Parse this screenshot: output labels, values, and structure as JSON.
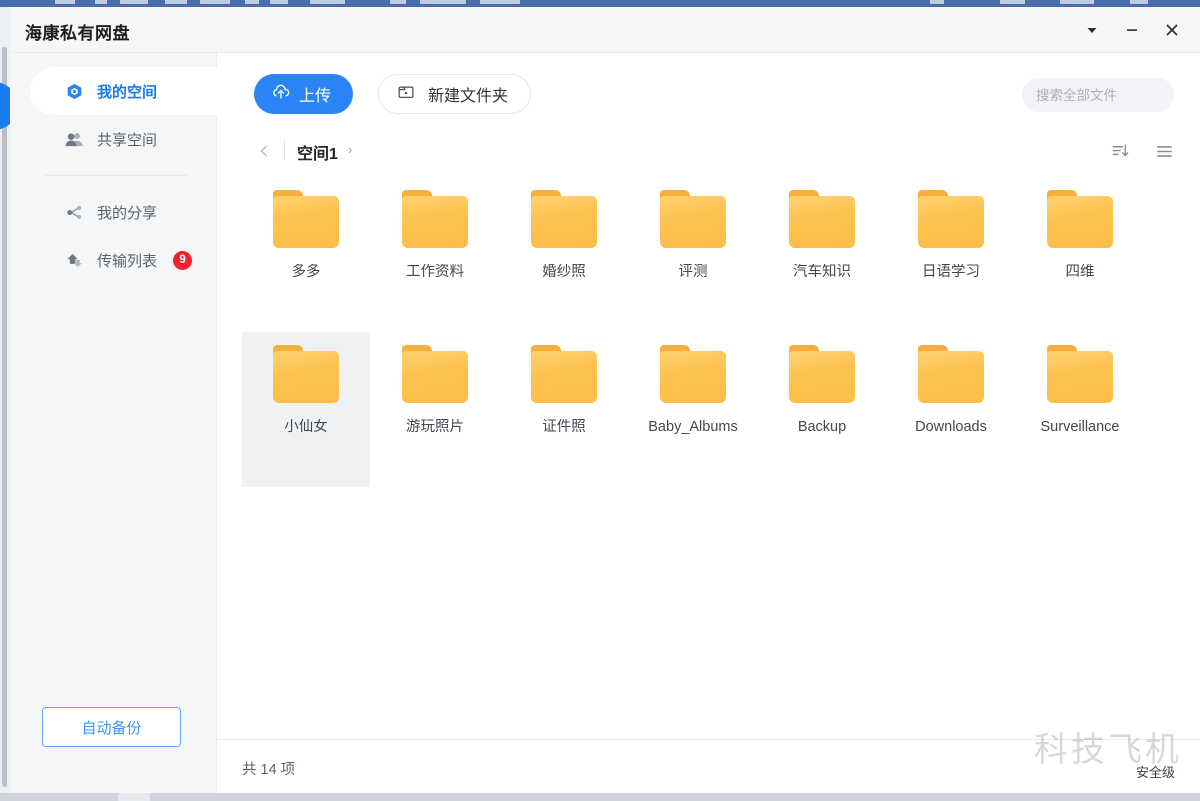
{
  "window": {
    "title": "海康私有网盘",
    "controls": [
      {
        "name": "dropdown-caret",
        "glyph": "▼"
      },
      {
        "name": "minimize",
        "glyph": "—"
      },
      {
        "name": "close",
        "glyph": "✕"
      }
    ]
  },
  "sidebar": {
    "items": [
      {
        "label": "我的空间",
        "icon": "cube-icon",
        "active": true,
        "badge": ""
      },
      {
        "label": "共享空间",
        "icon": "users-icon",
        "active": false,
        "badge": ""
      },
      {
        "label": "我的分享",
        "icon": "share-icon",
        "active": false,
        "badge": ""
      },
      {
        "label": "传输列表",
        "icon": "transfer-icon",
        "active": false,
        "badge": "9"
      }
    ],
    "auto_backup_label": "自动备份"
  },
  "toolbar": {
    "upload_label": "上传",
    "upload_icon": "cloud-upload-icon",
    "new_folder_label": "新建文件夹",
    "new_folder_icon": "folder-plus-icon",
    "accent_color": "#2b84f5"
  },
  "search": {
    "placeholder": "搜索全部文件",
    "value": "",
    "icon": "search-icon"
  },
  "breadcrumb": {
    "back_icon": "chevron-left-icon",
    "current": "空间1",
    "forward_chevron": "›"
  },
  "view_controls": [
    {
      "name": "sort-icon"
    },
    {
      "name": "list-view-icon"
    }
  ],
  "files": [
    {
      "name": "多多",
      "type": "folder",
      "selected": false
    },
    {
      "name": "工作资料",
      "type": "folder",
      "selected": false
    },
    {
      "name": "婚纱照",
      "type": "folder",
      "selected": false
    },
    {
      "name": "评测",
      "type": "folder",
      "selected": false
    },
    {
      "name": "汽车知识",
      "type": "folder",
      "selected": false
    },
    {
      "name": "日语学习",
      "type": "folder",
      "selected": false
    },
    {
      "name": "四维",
      "type": "folder",
      "selected": false
    },
    {
      "name": "小仙女",
      "type": "folder",
      "selected": true
    },
    {
      "name": "游玩照片",
      "type": "folder",
      "selected": false
    },
    {
      "name": "证件照",
      "type": "folder",
      "selected": false
    },
    {
      "name": "Baby_Albums",
      "type": "folder",
      "selected": false
    },
    {
      "name": "Backup",
      "type": "folder",
      "selected": false
    },
    {
      "name": "Downloads",
      "type": "folder",
      "selected": false
    },
    {
      "name": "Surveillance",
      "type": "folder",
      "selected": false
    }
  ],
  "footer": {
    "count_text": "共 14 项",
    "status_text": "安全级"
  },
  "watermark": {
    "text": "科技飞机"
  }
}
